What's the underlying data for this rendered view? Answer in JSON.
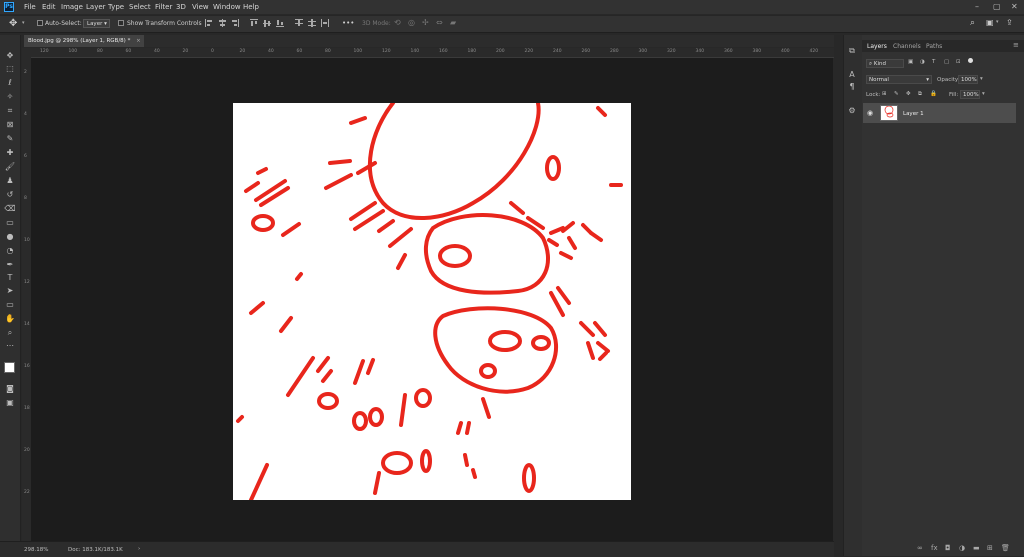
{
  "menubar": {
    "app_icon_label": "Ps",
    "items": [
      "File",
      "Edit",
      "Image",
      "Layer",
      "Type",
      "Select",
      "Filter",
      "3D",
      "View",
      "Window",
      "Help"
    ]
  },
  "options": {
    "auto_select_label": "Auto-Select:",
    "auto_select_value": "Layer",
    "show_transform_label": "Show Transform Controls",
    "mode_3d_label": "3D Mode:",
    "more_label": "•••"
  },
  "document": {
    "tab_title": "Blood.jpg @ 298% (Layer 1, RGB/8) *",
    "close_glyph": "×"
  },
  "ruler": {
    "h_ticks": [
      "120",
      "100",
      "80",
      "60",
      "40",
      "20",
      "0",
      "20",
      "40",
      "60",
      "80",
      "100",
      "120",
      "140",
      "160",
      "180",
      "200",
      "220",
      "240",
      "260",
      "280",
      "300",
      "320",
      "340",
      "360",
      "380",
      "400",
      "420"
    ],
    "v_ticks": [
      "2",
      "4",
      "6",
      "8",
      "10",
      "12",
      "14",
      "16",
      "18",
      "20",
      "22"
    ]
  },
  "status": {
    "zoom": "298.18%",
    "doc": "Doc: 183.1K/183.1K"
  },
  "panel": {
    "tabs": [
      "Layers",
      "Channels",
      "Paths"
    ],
    "filter_kind": "Kind",
    "blend_mode": "Normal",
    "opacity_label": "Opacity:",
    "opacity_value": "100%",
    "lock_label": "Lock:",
    "fill_label": "Fill:",
    "fill_value": "100%",
    "layer_name": "Layer 1"
  },
  "colors": {
    "stroke": "#e8261c",
    "canvas": "#ffffff",
    "pasteboard": "#1c1c1c",
    "selected_layer": "#4d4d4d"
  }
}
